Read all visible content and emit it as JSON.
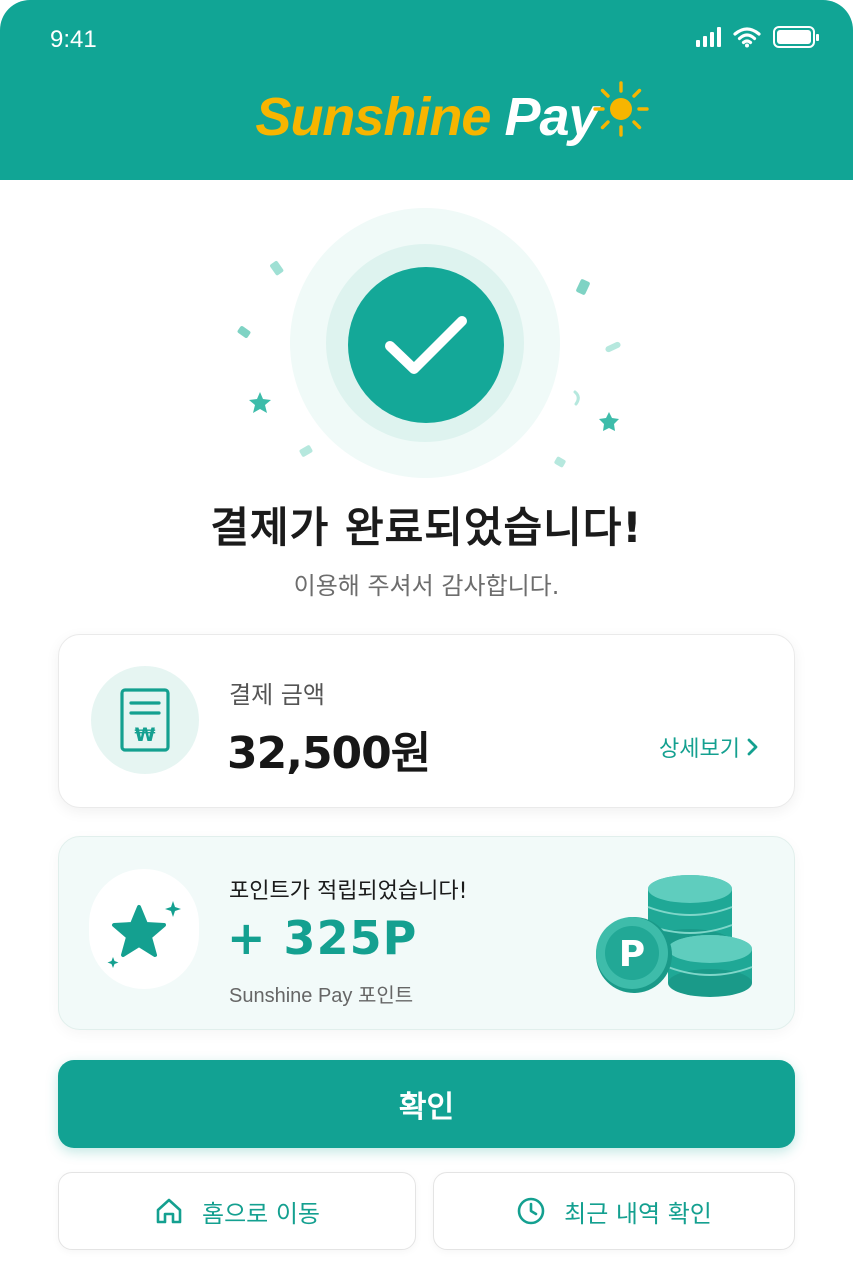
{
  "status_bar": {
    "time": "9:41"
  },
  "brand": {
    "part1": "Sunshine",
    "part2": "Pay"
  },
  "hero": {
    "title": "결제가 완료되었습니다!",
    "subtitle": "이용해 주셔서 감사합니다."
  },
  "payment": {
    "label": "결제 금액",
    "amount": "32,500원",
    "detail_link": "상세보기",
    "icon_symbol": "₩"
  },
  "points": {
    "title": "포인트가 적립되었습니다!",
    "value": "+ 325P",
    "subtitle": "Sunshine Pay 포인트",
    "coin_letter": "P"
  },
  "actions": {
    "confirm": "확인",
    "home": "홈으로 이동",
    "history": "최근 내역 확인"
  },
  "colors": {
    "brand_teal": "#11a595",
    "brand_yellow": "#f7b500",
    "accent_text": "#14a090"
  },
  "icons": [
    "signal-icon",
    "wifi-icon",
    "battery-icon",
    "sun-icon",
    "checkmark-icon",
    "receipt-icon",
    "star-icon",
    "coins-icon",
    "chevron-right-icon",
    "home-icon",
    "clock-icon"
  ]
}
